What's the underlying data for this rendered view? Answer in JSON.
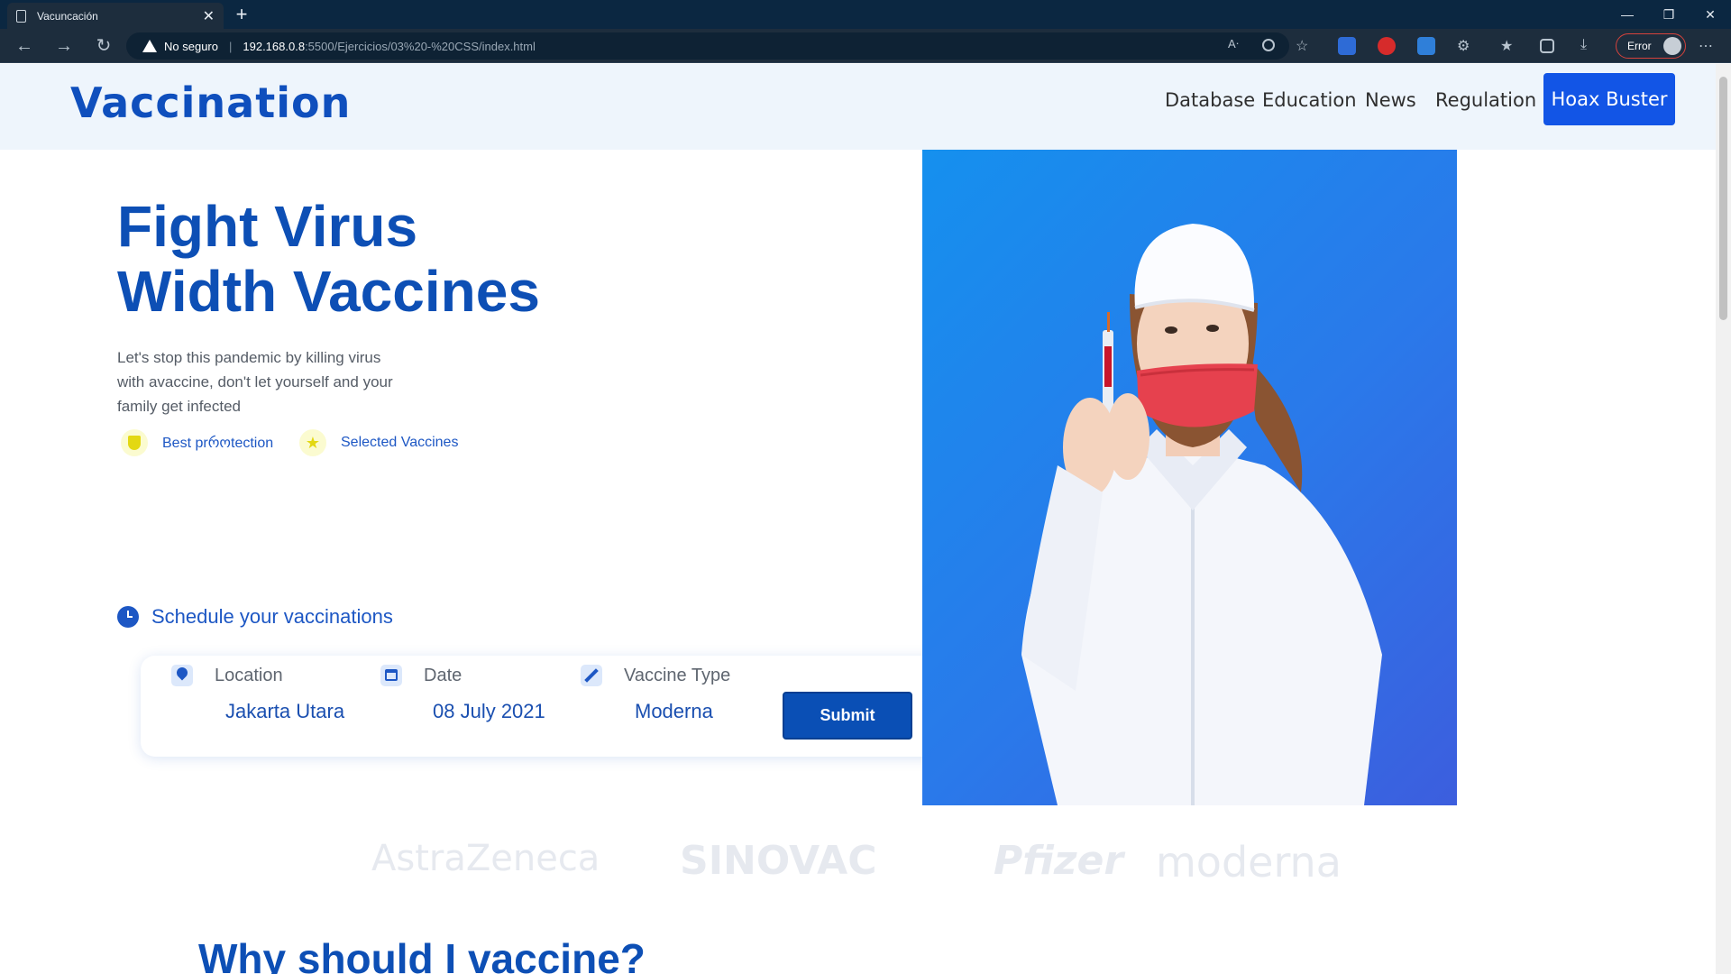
{
  "browser": {
    "tab_title": "Vacuncación",
    "close_glyph": "✕",
    "new_tab_glyph": "+",
    "security_label": "No seguro",
    "url_host": "192.168.0.8",
    "url_path": ":5500/Ejercicios/03%20-%20CSS/index.html",
    "profile_label": "Error",
    "icons": [
      "back-icon",
      "forward-icon",
      "refresh-icon",
      "read-aloud-icon",
      "zoom-icon",
      "favorite-add-icon",
      "translate-icon",
      "extension-icon",
      "extension-badge-icon",
      "extensions-icon",
      "favorites-icon",
      "collections-icon",
      "download-icon",
      "more-icon"
    ],
    "window_controls": [
      "—",
      "❐",
      "✕"
    ]
  },
  "nav": {
    "brand": "Vaccination",
    "links": [
      "Database",
      "Education",
      "News",
      "Regulation"
    ],
    "cta": "Hoax Buster"
  },
  "hero": {
    "title_line1": "Fight Virus",
    "title_line2": "Width Vaccines",
    "desc_line1": "Let's stop this pandemic by killing virus",
    "desc_line2": "with avaccine, don't let yourself and your",
    "desc_line3": "family get infected",
    "features": [
      "Best prროtection",
      "Selected Vaccines"
    ]
  },
  "schedule": {
    "heading": "Schedule your vaccinations",
    "fields": [
      {
        "label": "Location",
        "value": "Jakarta Utara"
      },
      {
        "label": "Date",
        "value": "08 July 2021"
      },
      {
        "label": "Vaccine Type",
        "value": "Moderna"
      }
    ],
    "submit": "Submit"
  },
  "logos": [
    "AstraZeneca",
    "SINOVAC",
    "Pfizer",
    "moderna"
  ],
  "section_title": "Why should I vaccine?",
  "colors": {
    "brand": "#0f4fbd",
    "cta": "#1255e6",
    "accent_yellow": "#e3d813"
  }
}
